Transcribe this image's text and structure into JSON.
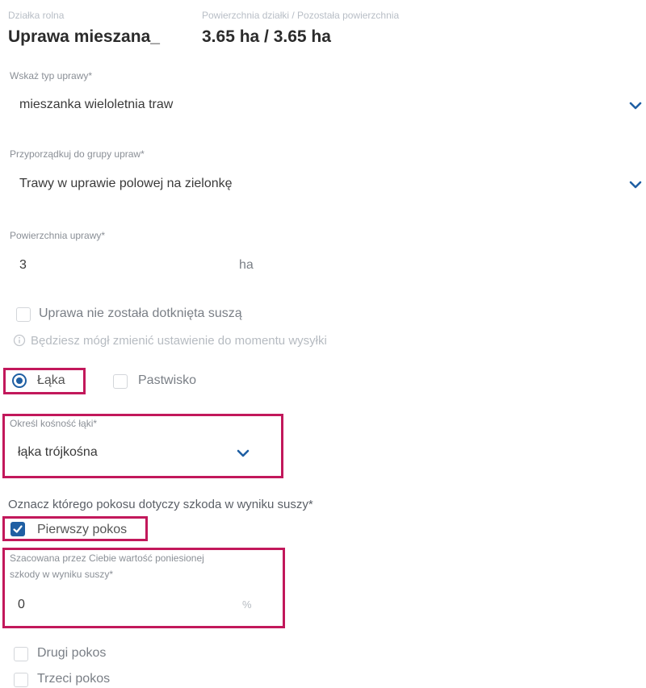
{
  "header": {
    "plot_name_label": "Działka rolna",
    "plot_name_value": "Uprawa mieszana_",
    "area_label": "Powierzchnia działki / Pozostała powierzchnia",
    "area_value": "3.65 ha / 3.65 ha"
  },
  "crop_type": {
    "label": "Wskaż typ uprawy*",
    "value": "mieszanka wieloletnia traw"
  },
  "crop_group": {
    "label": "Przyporządkuj do grupy upraw*",
    "value": "Trawy w uprawie polowej na zielonkę"
  },
  "crop_area": {
    "label": "Powierzchnia uprawy*",
    "value": "3",
    "unit": "ha"
  },
  "drought_checkbox": {
    "label": "Uprawa nie została dotknięta suszą",
    "checked": false
  },
  "info_note": {
    "text": "Będziesz mógł zmienić ustawienie do momentu wysyłki"
  },
  "land_type": {
    "options": [
      {
        "label": "Łąka",
        "selected": true
      },
      {
        "label": "Pastwisko",
        "selected": false
      }
    ]
  },
  "meadow_cut": {
    "label": "Określ kośność łąki*",
    "value": "łąka trójkośna"
  },
  "cut_question": {
    "label": "Oznacz którego pokosu dotyczy szkoda w wyniku suszy*"
  },
  "cuts": {
    "first": {
      "label": "Pierwszy pokos",
      "checked": true
    },
    "second": {
      "label": "Drugi pokos",
      "checked": false
    },
    "third": {
      "label": "Trzeci pokos",
      "checked": false
    }
  },
  "damage_estimate": {
    "label_line1": "Szacowana przez Ciebie wartość poniesionej",
    "label_line2": "szkody w wyniku suszy*",
    "value": "0",
    "unit": "%"
  },
  "colors": {
    "accent": "#1f5fa3",
    "highlight": "#c2185b"
  }
}
